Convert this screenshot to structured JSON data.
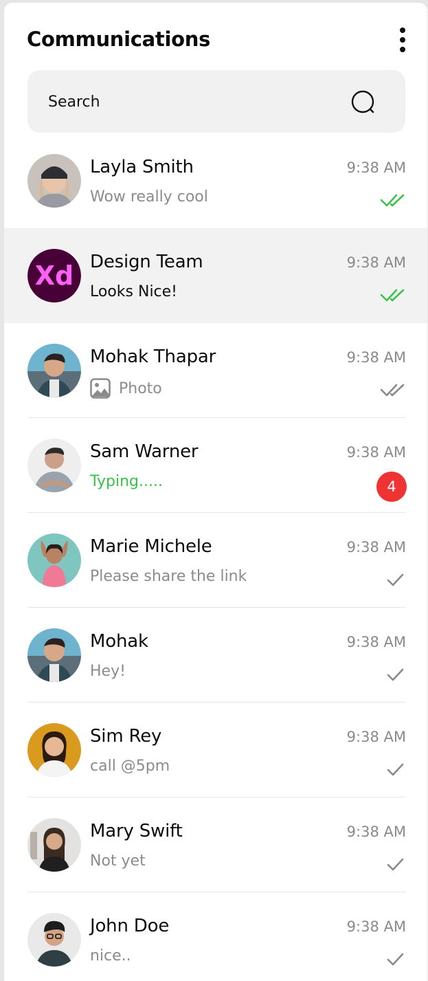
{
  "header": {
    "title": "Communications"
  },
  "search": {
    "placeholder": "Search"
  },
  "colors": {
    "read_tick": "#3cc24b",
    "delivered_tick": "#8a8a8a",
    "typing": "#37c24a",
    "badge": "#ef3333",
    "selected_row": "#f2f2f2"
  },
  "conversations": [
    {
      "name": "Layla Smith",
      "time": "9:38 AM",
      "preview": "Wow really cool",
      "status": "read",
      "avatar": "avatar-photo"
    },
    {
      "name": "Design Team",
      "time": "9:38 AM",
      "preview": "Looks Nice!",
      "status": "read",
      "avatar": "xd-logo",
      "avatar_text": "Xd",
      "selected": true
    },
    {
      "name": "Mohak Thapar",
      "time": "9:38 AM",
      "preview": "Photo",
      "preview_icon": "photo-icon",
      "status": "delivered",
      "avatar": "avatar-photo"
    },
    {
      "name": "Sam Warner",
      "time": "9:38 AM",
      "preview": "Typing.....",
      "unread_count": "4",
      "avatar": "avatar-photo"
    },
    {
      "name": "Marie Michele",
      "time": "9:38 AM",
      "preview": "Please share the link",
      "status": "sent",
      "avatar": "avatar-photo"
    },
    {
      "name": "Mohak",
      "time": "9:38 AM",
      "preview": "Hey!",
      "status": "sent",
      "avatar": "avatar-photo"
    },
    {
      "name": "Sim Rey",
      "time": "9:38 AM",
      "preview": "call @5pm",
      "status": "sent",
      "avatar": "avatar-photo"
    },
    {
      "name": "Mary Swift",
      "time": "9:38 AM",
      "preview": "Not yet",
      "status": "sent",
      "avatar": "avatar-photo"
    },
    {
      "name": "John Doe",
      "time": "9:38 AM",
      "preview": "nice..",
      "status": "sent",
      "avatar": "avatar-photo"
    }
  ]
}
